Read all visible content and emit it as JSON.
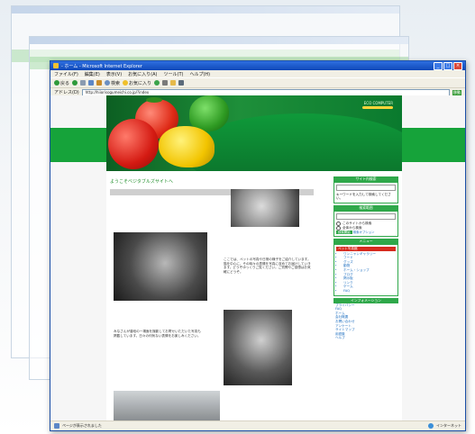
{
  "window": {
    "title": "- ホーム - Microsoft Internet Explorer",
    "accent": "#1b4fa8"
  },
  "menu": [
    "ファイル(F)",
    "編集(E)",
    "表示(V)",
    "お気に入り(A)",
    "ツール(T)",
    "ヘルプ(H)"
  ],
  "toolbar": {
    "back": "戻る",
    "search": "検索",
    "favorites": "お気に入り"
  },
  "address": {
    "label": "アドレス(D)",
    "url": "http://hiiorisogumeichi.co.jp/?index",
    "go": "移動"
  },
  "site": {
    "logo": "ECO COMPUTER",
    "brand_color": "#16a33a",
    "welcome": "ようこそベジタブルズサイトへ",
    "text1": "ここでは、ペットの写真や日常の様子をご紹介しています。猫を中心に、その時々の表情を写真に収めてお届けしていきます。どうぞゆっくりご覧ください。ご質問やご感想はお気軽にどうぞ。",
    "text2": "みなさんが普段の一場面を撮影してお寄せいただいた写真も掲載しています。日々の何気ない表情をお楽しみください。"
  },
  "sidebar": {
    "search_head": "サイト内検索",
    "search_text": "キーワードを入力して検索してください。",
    "range_head": "検索範囲",
    "radio1": "このサイトから検索",
    "radio2": "全体から検索",
    "search_btn": "検索開始",
    "search_opt": "検索オプション",
    "menu_head": "メニュー",
    "menu_red": "ペット写真館",
    "menu_items": [
      "ワンニャンギャラリー",
      "フード",
      "グッズ",
      "動物",
      "ホーム・ショップ",
      "ブログ",
      "掲示板",
      "リンク",
      "ゲーム",
      "FAQ"
    ],
    "links_head": "インフォメーション",
    "links": [
      "プライバシー",
      "FAQ",
      "ホーム",
      "会社概要",
      "お問い合わせ",
      "アンケート",
      "サイトマップ",
      "用語集",
      "ヘルプ"
    ]
  },
  "status": {
    "text": "ページが表示されました",
    "zone": "インターネット"
  }
}
